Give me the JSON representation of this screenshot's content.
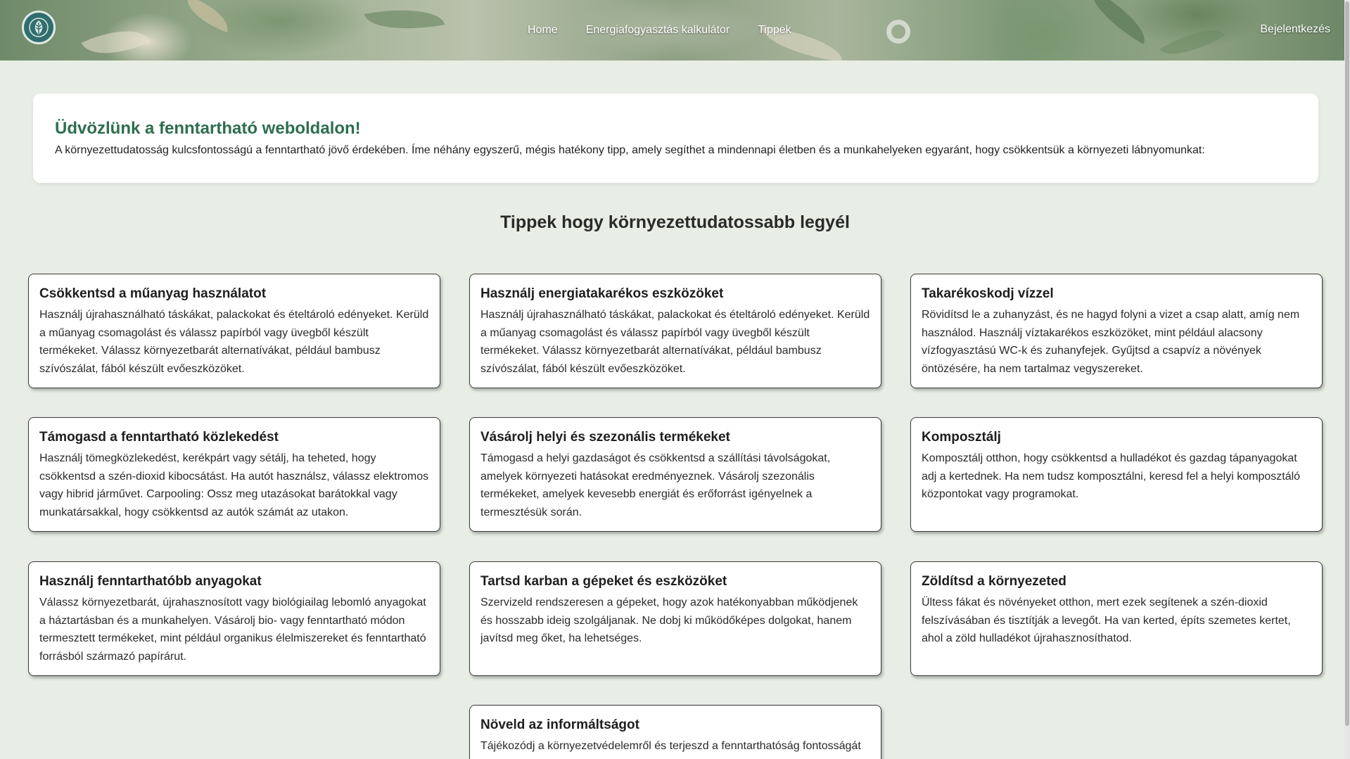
{
  "header": {
    "logo_icon": "leaf-logo-icon",
    "nav": [
      {
        "label": "Home"
      },
      {
        "label": "Energiafogyasztás kalkulátor"
      },
      {
        "label": "Tippek"
      }
    ],
    "login_label": "Bejelentkezés"
  },
  "welcome": {
    "title": "Üdvözlünk a fenntartható weboldalon!",
    "text": "A környezettudatosság kulcsfontosságú a fenntartható jövő érdekében. Íme néhány egyszerű, mégis hatékony tipp, amely segíthet a mindennapi életben és a munkahelyeken egyaránt, hogy csökkentsük a környezeti lábnyomunkat:"
  },
  "tips_section": {
    "title": "Tippek hogy környezettudatossabb legyél",
    "cards": [
      {
        "title": "Csökkentsd a műanyag használatot",
        "text": "Használj újrahasználható táskákat, palackokat és ételtároló edényeket. Kerüld a műanyag csomagolást és válassz papírból vagy üvegből készült termékeket. Válassz környezetbarát alternatívákat, például bambusz szívószálat, fából készült evőeszközöket."
      },
      {
        "title": "Használj energiatakarékos eszközöket",
        "text": "Használj újrahasználható táskákat, palackokat és ételtároló edényeket. Kerüld a műanyag csomagolást és válassz papírból vagy üvegből készült termékeket. Válassz környezetbarát alternatívákat, például bambusz szívószálat, fából készült evőeszközöket."
      },
      {
        "title": "Takarékoskodj vízzel",
        "text": "Rövidítsd le a zuhanyzást, és ne hagyd folyni a vizet a csap alatt, amíg nem használod. Használj víztakarékos eszközöket, mint például alacsony vízfogyasztású WC-k és zuhanyfejek. Gyűjtsd a csapvíz a növények öntözésére, ha nem tartalmaz vegyszereket."
      },
      {
        "title": "Támogasd a fenntartható közlekedést",
        "text": "Használj tömegközlekedést, kerékpárt vagy sétálj, ha teheted, hogy csökkentsd a szén-dioxid kibocsátást. Ha autót használsz, válassz elektromos vagy hibrid járművet. Carpooling: Ossz meg utazásokat barátokkal vagy munkatársakkal, hogy csökkentsd az autók számát az utakon."
      },
      {
        "title": "Vásárolj helyi és szezonális termékeket",
        "text": "Támogasd a helyi gazdaságot és csökkentsd a szállítási távolságokat, amelyek környezeti hatásokat eredményeznek. Vásárolj szezonális termékeket, amelyek kevesebb energiát és erőforrást igényelnek a termesztésük során."
      },
      {
        "title": "Komposztálj",
        "text": "Komposztálj otthon, hogy csökkentsd a hulladékot és gazdag tápanyagokat adj a kertednek. Ha nem tudsz komposztálni, keresd fel a helyi komposztáló központokat vagy programokat."
      },
      {
        "title": "Használj fenntarthatóbb anyagokat",
        "text": "Válassz környezetbarát, újrahasznosított vagy biológiailag lebomló anyagokat a háztartásban és a munkahelyen. Vásárolj bio- vagy fenntartható módon termesztett termékeket, mint például organikus élelmiszereket és fenntartható forrásból származó papírárut."
      },
      {
        "title": "Tartsd karban a gépeket és eszközöket",
        "text": "Szervizeld rendszeresen a gépeket, hogy azok hatékonyabban működjenek és hosszabb ideig szolgáljanak. Ne dobj ki működőképes dolgokat, hanem javítsd meg őket, ha lehetséges."
      },
      {
        "title": "Zöldítsd a környezeted",
        "text": "Ültess fákat és növényeket otthon, mert ezek segítenek a szén-dioxid felszívásában és tisztítják a levegőt. Ha van kerted, építs szemetes kertet, ahol a zöld hulladékot újrahasznosíthatod."
      },
      {
        "title": "Növeld az informáltságot",
        "text": "Tájékozódj a környezetvédelemről és terjeszd a fenntarthatóság fontosságát"
      }
    ]
  }
}
